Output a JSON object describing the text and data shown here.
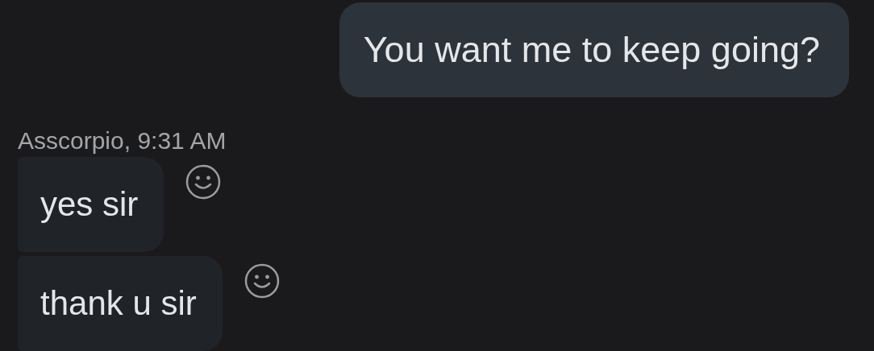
{
  "messages": [
    {
      "kind": "outgoing",
      "text": "You want me to keep going?"
    },
    {
      "kind": "sender",
      "text": "Asscorpio, 9:31 AM"
    },
    {
      "kind": "incoming",
      "text": "yes sir"
    },
    {
      "kind": "incoming",
      "text": "thank u sir"
    }
  ]
}
